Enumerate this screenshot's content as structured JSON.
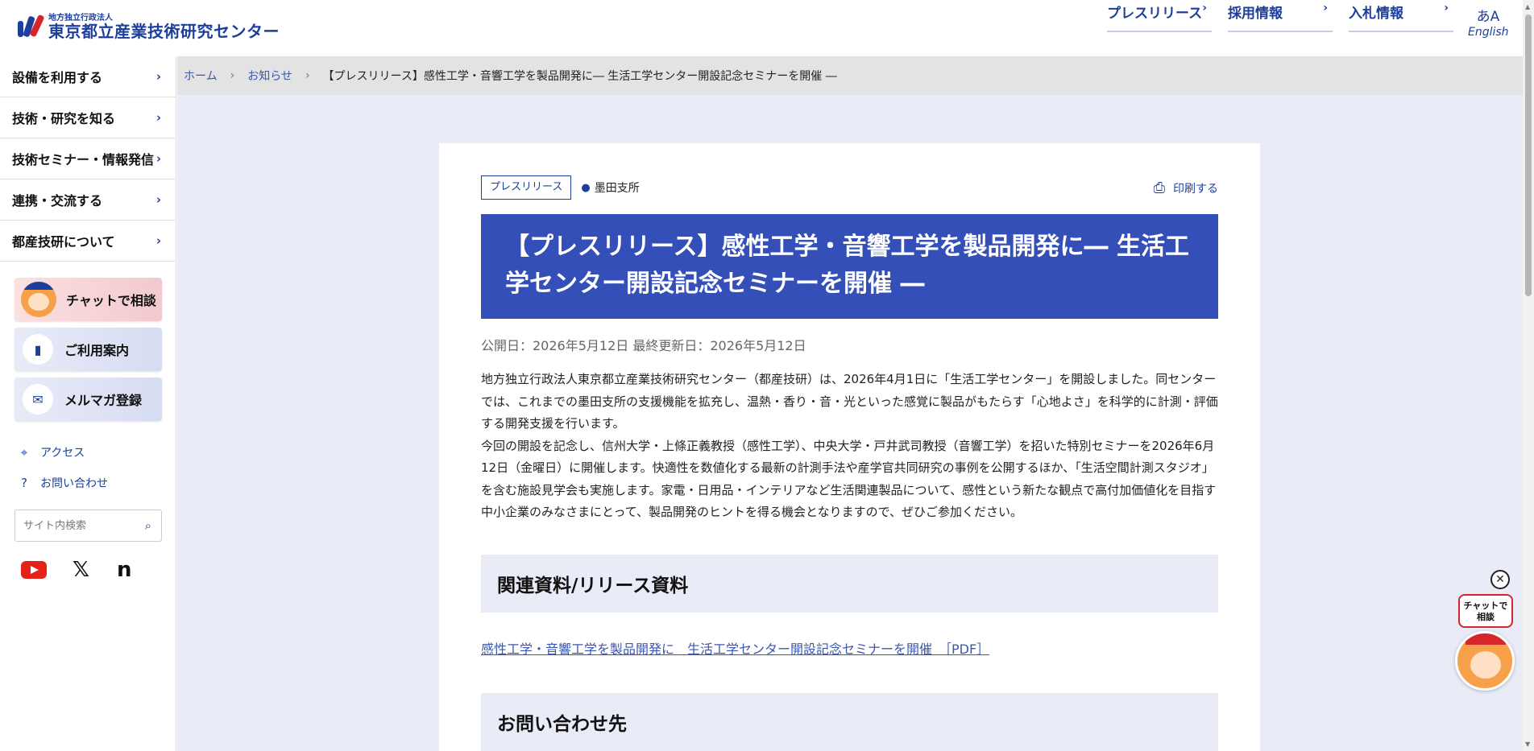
{
  "header": {
    "logo_sub": "地方独立行政法人",
    "logo_main": "東京都立産業技術研究センター",
    "nav": [
      {
        "label": "プレスリリース"
      },
      {
        "label": "採用情報"
      },
      {
        "label": "入札情報"
      }
    ],
    "lang_label": "English",
    "lang_icon": "translate-icon"
  },
  "sidebar": {
    "menu": [
      {
        "label": "設備を利用する"
      },
      {
        "label": "技術・研究を知る"
      },
      {
        "label": "技術セミナー・情報発信"
      },
      {
        "label": "連携・交流する"
      },
      {
        "label": "都産技研について"
      }
    ],
    "buttons": {
      "chat": "チャットで相談",
      "guide": "ご利用案内",
      "mail": "メルマガ登録"
    },
    "links": {
      "access": "アクセス",
      "contact": "お問い合わせ"
    },
    "search_placeholder": "サイト内検索"
  },
  "breadcrumb": {
    "home": "ホーム",
    "news": "お知らせ",
    "current": "【プレスリリース】感性工学・音響工学を製品開発に― 生活工学センター開設記念セミナーを開催 ―"
  },
  "article": {
    "tag": "プレスリリース",
    "location": "墨田支所",
    "print_label": "印刷する",
    "title": "【プレスリリース】感性工学・音響工学を製品開発に― 生活工学センター開設記念セミナーを開催 ―",
    "dates": "公開日：2026年5月12日 最終更新日：2026年5月12日",
    "paragraph1": "地方独立行政法人東京都立産業技術研究センター（都産技研）は、2026年4月1日に「生活工学センター」を開設しました。同センターでは、これまでの墨田支所の支援機能を拡充し、温熱・香り・音・光といった感覚に製品がもたらす「心地よさ」を科学的に計測・評価する開発支援を行います。",
    "paragraph2": "今回の開設を記念し、信州大学・上條正義教授（感性工学）、中央大学・戸井武司教授（音響工学）を招いた特別セミナーを2026年6月12日（金曜日）に開催します。快適性を数値化する最新の計測手法や産学官共同研究の事例を公開するほか、「生活空間計測スタジオ」を含む施設見学会も実施します。家電・日用品・インテリアなど生活関連製品について、感性という新たな観点で高付加価値化を目指す中小企業のみなさまにとって、製品開発のヒントを得る機会となりますので、ぜひご参加ください。",
    "section1": "関連資料/リリース資料",
    "doc_link": "感性工学・音響工学を製品開発に　生活工学センター開設記念セミナーを開催　［PDF］",
    "section2": "お問い合わせ先"
  },
  "float_chat": {
    "bubble": "チャットで相談"
  }
}
